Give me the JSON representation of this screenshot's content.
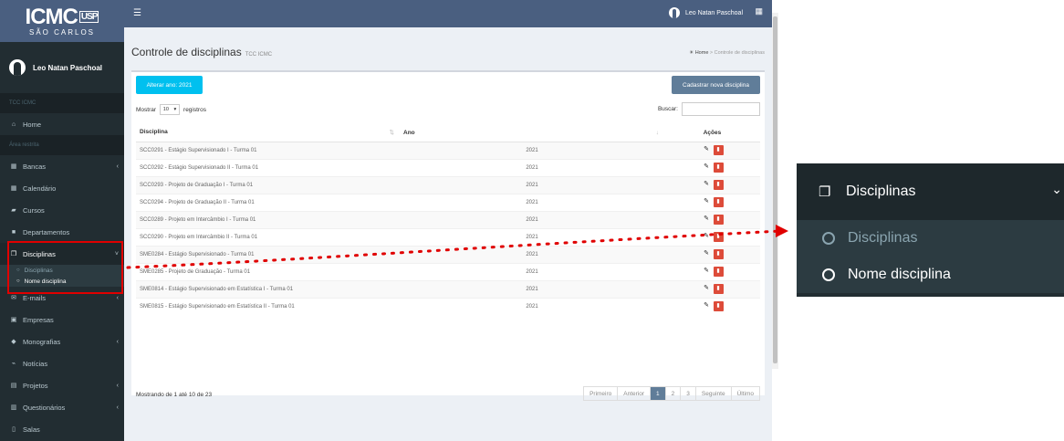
{
  "logo": {
    "brand": "ICMC",
    "brand_mark": "USP",
    "sub": "SÃO CARLOS"
  },
  "user": {
    "name": "Leo Natan Paschoal"
  },
  "sidebar": {
    "section_tcc": "TCC ICMC",
    "home": "Home",
    "section_restrita": "Área restrita",
    "items": [
      {
        "label": "Bancas",
        "icon": "calendar-icon",
        "has_chevron": true
      },
      {
        "label": "Calendário",
        "icon": "calendar-icon",
        "has_chevron": false
      },
      {
        "label": "Cursos",
        "icon": "book-icon",
        "has_chevron": false
      },
      {
        "label": "Departamentos",
        "icon": "building-icon",
        "has_chevron": false
      },
      {
        "label": "Disciplinas",
        "icon": "copy-icon",
        "has_chevron": true,
        "active": true
      },
      {
        "label": "E-mails",
        "icon": "envelope-icon",
        "has_chevron": true
      },
      {
        "label": "Empresas",
        "icon": "id-card-icon",
        "has_chevron": false
      },
      {
        "label": "Monografias",
        "icon": "graduation-cap-icon",
        "has_chevron": true
      },
      {
        "label": "Notícias",
        "icon": "rss-icon",
        "has_chevron": false
      },
      {
        "label": "Projetos",
        "icon": "file-icon",
        "has_chevron": true
      },
      {
        "label": "Questionários",
        "icon": "file-text-icon",
        "has_chevron": true
      },
      {
        "label": "Salas",
        "icon": "door-icon",
        "has_chevron": false
      }
    ],
    "submenu": [
      {
        "label": "Disciplinas",
        "on": false
      },
      {
        "label": "Nome disciplina",
        "on": true
      }
    ]
  },
  "topbar": {
    "user_name": "Leo Natan Paschoal"
  },
  "page": {
    "title": "Controle de disciplinas",
    "subtitle": "TCC ICMC",
    "breadcrumb_home": "Home",
    "breadcrumb_sep": ">",
    "breadcrumb_current": "Controle de disciplinas"
  },
  "toolbar": {
    "year_button": "Alterar ano: 2021",
    "new_button": "Cadastrar nova disciplina",
    "show_label": "Mostrar",
    "page_size": "10",
    "records_label": "registros",
    "search_label": "Buscar:",
    "search_value": ""
  },
  "table": {
    "headers": {
      "discipline": "Disciplina",
      "year": "Ano",
      "actions": "Ações"
    },
    "rows": [
      {
        "discipline": "SCC0291 - Estágio Supervisionado I - Turma 01",
        "year": "2021"
      },
      {
        "discipline": "SCC0292 - Estágio Supervisionado II - Turma 01",
        "year": "2021"
      },
      {
        "discipline": "SCC0293 - Projeto de Graduação I - Turma 01",
        "year": "2021"
      },
      {
        "discipline": "SCC0294 - Projeto de Graduação II - Turma 01",
        "year": "2021"
      },
      {
        "discipline": "SCC0289 - Projeto em Intercâmbio I - Turma 01",
        "year": "2021"
      },
      {
        "discipline": "SCC0290 - Projeto em Intercâmbio II - Turma 01",
        "year": "2021"
      },
      {
        "discipline": "SME0284 - Estágio Supervisionado - Turma 01",
        "year": "2021"
      },
      {
        "discipline": "SME0285 - Projeto de Graduação - Turma 01",
        "year": "2021"
      },
      {
        "discipline": "SME0814 - Estágio Supervisionado em Estatística I - Turma 01",
        "year": "2021"
      },
      {
        "discipline": "SME0815 - Estágio Supervisionado em Estatística II - Turma 01",
        "year": "2021"
      }
    ]
  },
  "footer": {
    "info": "Mostrando de 1 até 10 de 23",
    "pager": [
      "Primeiro",
      "Anterior",
      "1",
      "2",
      "3",
      "Seguinte",
      "Último"
    ],
    "current_page": "1"
  },
  "zoom": {
    "header": "Disciplinas",
    "items": [
      {
        "label": "Disciplinas",
        "on": false
      },
      {
        "label": "Nome disciplina",
        "on": true
      }
    ]
  },
  "colors": {
    "sidebar": "#222d32",
    "topbar": "#4a5f80",
    "year_button": "#00c0ef",
    "new_button": "#607d99",
    "delete": "#dd4b39",
    "highlight": "#e00000"
  }
}
